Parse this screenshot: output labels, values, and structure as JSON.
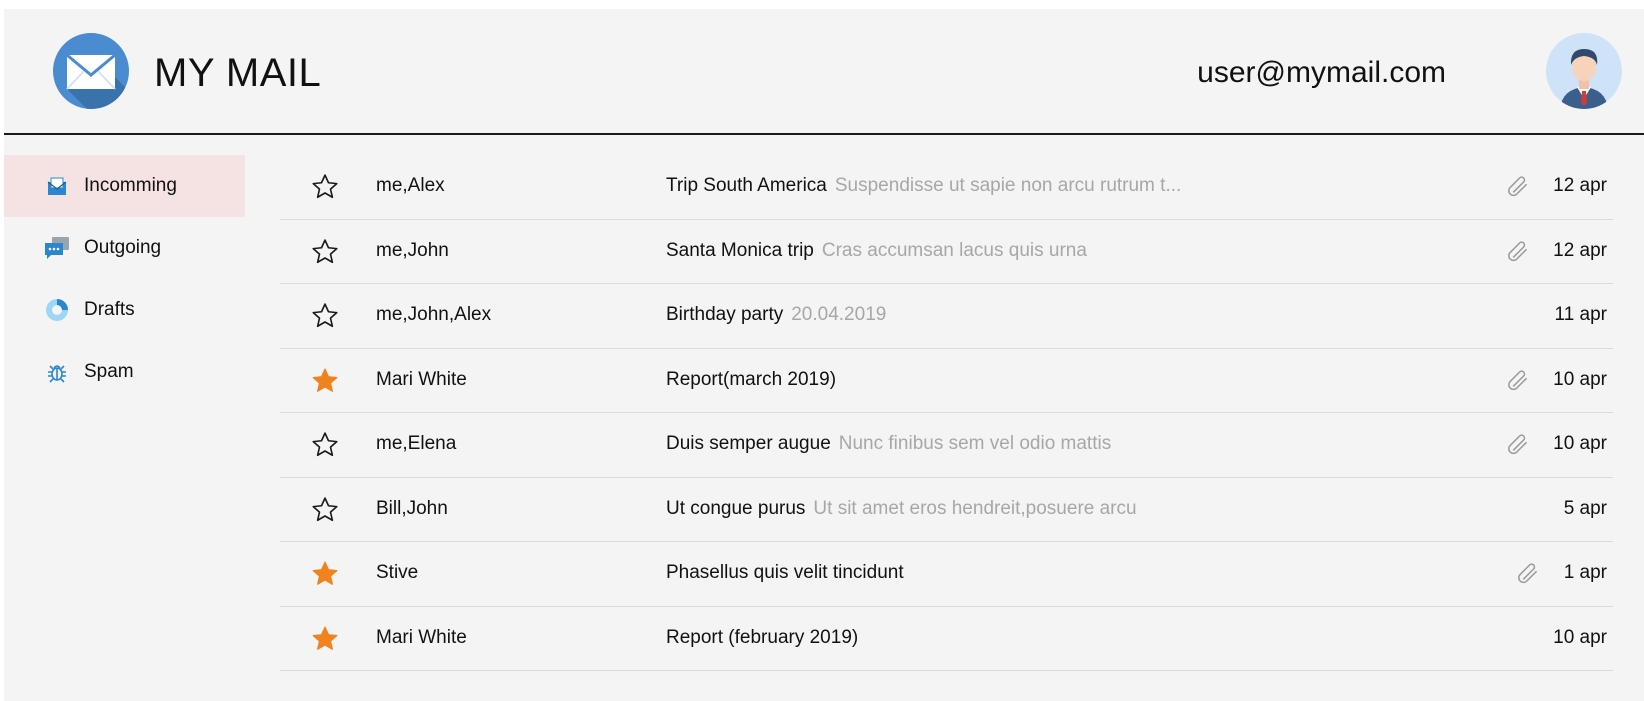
{
  "header": {
    "title": "MY MAIL",
    "user_email": "user@mymail.com",
    "logo_icon": "envelope-icon",
    "avatar_icon": "user-avatar"
  },
  "sidebar": {
    "items": [
      {
        "label": "Incomming",
        "icon": "envelope-open-icon",
        "active": true
      },
      {
        "label": "Outgoing",
        "icon": "chat-bubbles-icon",
        "active": false
      },
      {
        "label": "Drafts",
        "icon": "donut-icon",
        "active": false
      },
      {
        "label": "Spam",
        "icon": "bug-icon",
        "active": false
      }
    ]
  },
  "colors": {
    "accent": "#3a93d8",
    "active_nav_bg": "#f5e3e3",
    "star_filled": "#f0831d",
    "preview_text": "#a7a7a7",
    "background": "#f4f4f4"
  },
  "messages": [
    {
      "starred": false,
      "sender": "me,Alex",
      "subject": "Trip South America",
      "preview": "Suspendisse ut sapie non arcu rutrum t...",
      "attachment": true,
      "date": "12 apr"
    },
    {
      "starred": false,
      "sender": "me,John",
      "subject": "Santa Monica trip",
      "preview": "Cras accumsan lacus quis urna",
      "attachment": true,
      "date": "12 apr"
    },
    {
      "starred": false,
      "sender": "me,John,Alex",
      "subject": "Birthday party",
      "preview": "20.04.2019",
      "attachment": false,
      "date": "11 apr"
    },
    {
      "starred": true,
      "sender": "Mari White",
      "subject": "Report(march 2019)",
      "preview": "",
      "attachment": true,
      "date": "10 apr"
    },
    {
      "starred": false,
      "sender": "me,Elena",
      "subject": "Duis semper augue",
      "preview": "Nunc finibus sem vel odio mattis",
      "attachment": true,
      "date": "10 apr"
    },
    {
      "starred": false,
      "sender": "Bill,John",
      "subject": "Ut congue purus",
      "preview": "Ut sit amet eros hendreit,posuere arcu",
      "attachment": false,
      "date": "5 apr"
    },
    {
      "starred": true,
      "sender": "Stive",
      "subject": "Phasellus quis velit tincidunt",
      "preview": "",
      "attachment": true,
      "date": "1 apr"
    },
    {
      "starred": true,
      "sender": "Mari White",
      "subject": "Report (february 2019)",
      "preview": "",
      "attachment": false,
      "date": "10 apr"
    }
  ]
}
